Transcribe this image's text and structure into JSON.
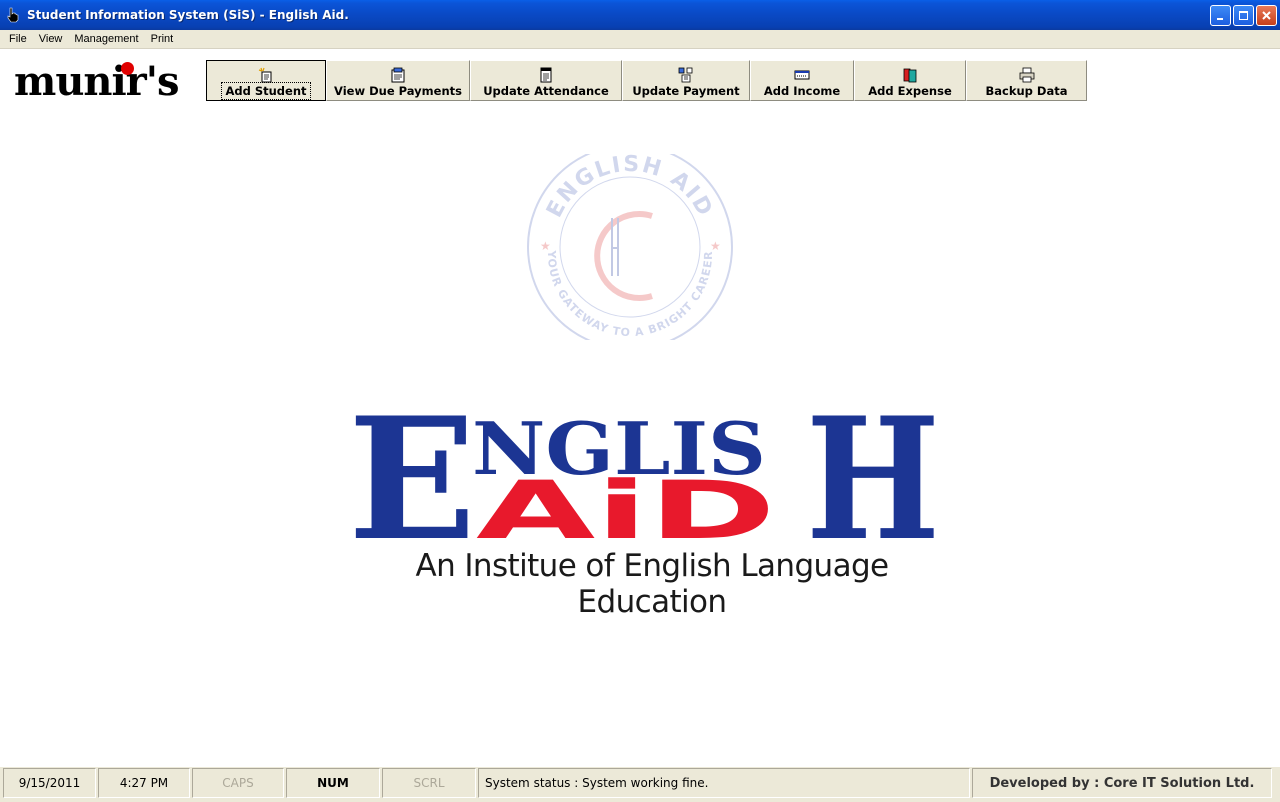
{
  "window": {
    "title": "Student Information System (SiS) - English Aid.",
    "controls": [
      "minimize",
      "maximize",
      "close"
    ]
  },
  "menu": {
    "items": [
      "File",
      "View",
      "Management",
      "Print"
    ]
  },
  "brand": {
    "logo_text": "munir's"
  },
  "toolbar": {
    "buttons": [
      {
        "label": "Add Student",
        "icon": "add-student-icon"
      },
      {
        "label": "View Due Payments",
        "icon": "due-payments-icon"
      },
      {
        "label": "Update Attendance",
        "icon": "attendance-icon"
      },
      {
        "label": "Update Payment",
        "icon": "payment-icon"
      },
      {
        "label": "Add Income",
        "icon": "income-icon"
      },
      {
        "label": "Add Expense",
        "icon": "expense-icon"
      },
      {
        "label": "Backup Data",
        "icon": "backup-icon"
      }
    ],
    "active_index": 0
  },
  "seal": {
    "top_text": "ENGLISH AID",
    "bottom_text": "YOUR GATEWAY TO A BRIGHT CAREER"
  },
  "logo": {
    "big_letter_left": "E",
    "top_letters": "NGLIS",
    "big_letter_right": "H",
    "aid_text": "AiD",
    "tagline": "An Institue of English Language Education"
  },
  "statusbar": {
    "date": "9/15/2011",
    "time": "4:27 PM",
    "caps": "CAPS",
    "num": "NUM",
    "scrl": "SCRL",
    "status_message": "System status : System working fine.",
    "credit": "Developed by : Core IT Solution Ltd."
  },
  "colors": {
    "logo_blue": "#1c3593",
    "logo_red": "#e8192c",
    "brand_dot": "#e00000",
    "titlebar_blue": "#0a49c4",
    "chrome": "#ece9d8"
  }
}
